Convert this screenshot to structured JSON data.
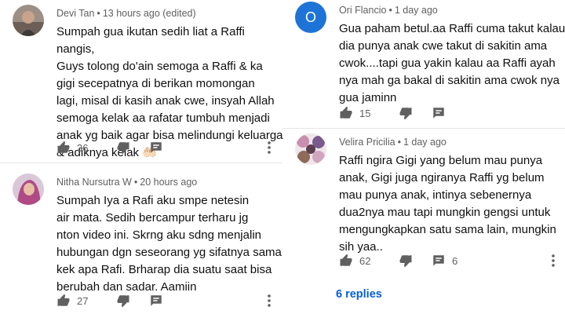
{
  "colors": {
    "link": "#065fd4",
    "meta": "#606060",
    "o_avatar_bg": "#1e73d6"
  },
  "comments": [
    {
      "author": "Devi Tan",
      "time": "13 hours ago (edited)",
      "text": "Sumpah gua ikutan sedih liat a Raffi nangis,\nGuys tolong do'ain semoga a Raffi & ka\ngigi secepatnya di berikan momongan\nlagi, misal di kasih anak cwe, insyah Allah\nsemoga kelak aa rafatar tumbuh menjadi\nanak yg baik  agar bisa melindungi keluarga\n& adiknya kelak 🤲🏻",
      "likes": "36"
    },
    {
      "author": "Nitha Nursutra W",
      "time": "20 hours ago",
      "text": "Sumpah Iya a Rafi aku smpe netesin\nair mata. Sedih bercampur terharu jg\nnton video ini. Skrng aku sdng menjalin\nhubungan dgn seseorang yg sifatnya sama\nkek apa Rafi. Brharap dia suatu saat bisa\nberubah dan sadar. Aamiin",
      "likes": "27"
    },
    {
      "author": "Ori Flancio",
      "time": "1 day ago",
      "avatar_letter": "O",
      "text": "Gua paham betul.aa Raffi cuma takut kalau\ndia punya anak cwe takut di sakitin ama\ncwok....tapi gua yakin kalau aa Raffi ayah\nnya mah ga bakal di sakitin ama cwok nya\ngua jaminn",
      "likes": "15"
    },
    {
      "author": "Velira Pricilia",
      "time": "1 day ago",
      "text": "Raffi ngira Gigi yang belum mau punya\nanak, Gigi juga ngiranya Raffi yg belum\nmau punya anak, intinya sebenernya\ndua2nya mau tapi mungkin gengsi untuk\nmengungkapkan satu sama lain, mungkin\nsih yaa..",
      "likes": "62",
      "replies": "6"
    }
  ],
  "view_replies": "6 replies"
}
